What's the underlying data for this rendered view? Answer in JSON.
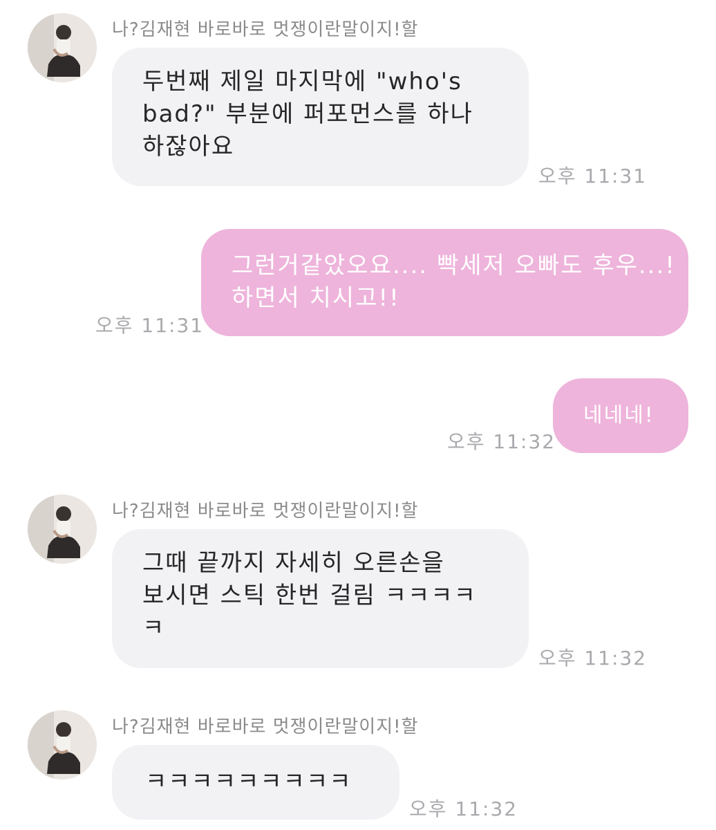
{
  "chat": {
    "sender_name": "나?김재현 바로바로 멋쟁이란말이지!할",
    "messages": [
      {
        "direction": "received",
        "show_sender": true,
        "lines": [
          "두번째 제일 마지막에 \"who's",
          "bad?\" 부분에 퍼포먼스를 하나",
          "하잖아요"
        ],
        "time": "오후 11:31"
      },
      {
        "direction": "sent",
        "lines": [
          "그런거같았오요.... 빡세저 오빠도 후우...!",
          "하면서 치시고!!"
        ],
        "time": "오후 11:31"
      },
      {
        "direction": "sent",
        "lines": [
          "네네네!"
        ],
        "time": "오후 11:32"
      },
      {
        "direction": "received",
        "show_sender": true,
        "lines": [
          "그때 끝까지 자세히 오른손을",
          "보시면 스틱 한번 걸림 ㅋㅋㅋㅋ",
          "ㅋ"
        ],
        "time": "오후 11:32"
      },
      {
        "direction": "received",
        "show_sender": true,
        "lines": [
          "ㅋㅋㅋㅋㅋㅋㅋㅋㅋ"
        ],
        "time": "오후 11:32"
      }
    ]
  },
  "colors": {
    "sent_bubble": "#eeb4db",
    "received_bubble": "#f2f2f5",
    "timestamp": "#a9a9ad",
    "sender_name": "#8a8a8a"
  }
}
